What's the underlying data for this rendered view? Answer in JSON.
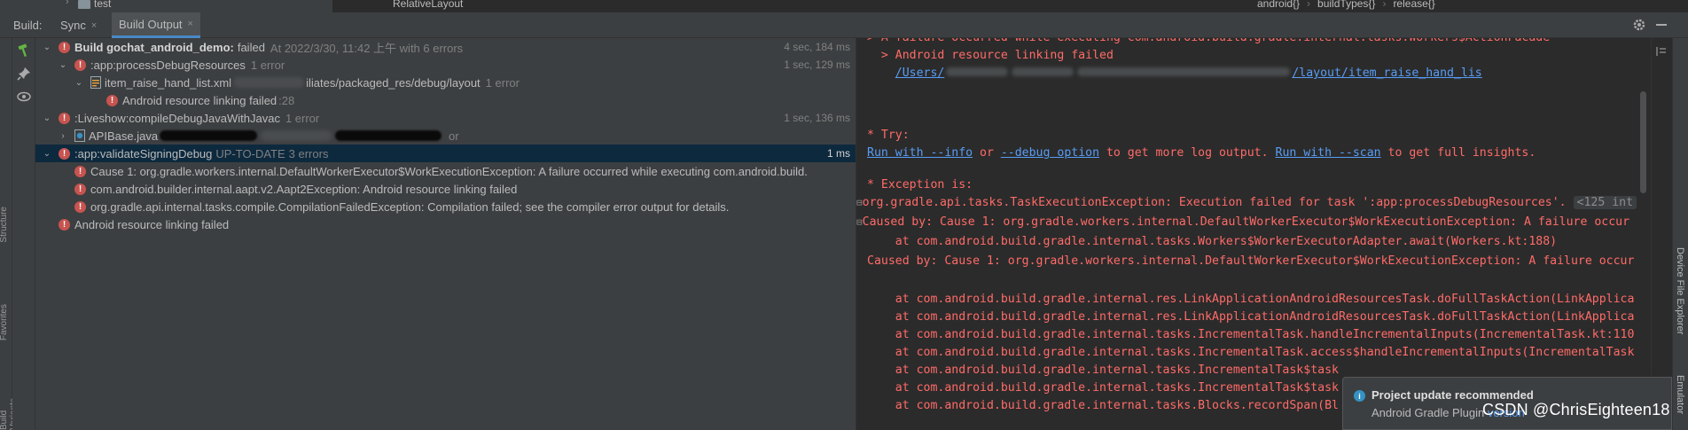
{
  "editor": {
    "tree_item": "test",
    "layout_name": "RelativeLayout",
    "breadcrumbs": [
      "android{}",
      "buildTypes{}",
      "release{}"
    ]
  },
  "toolwindow": {
    "title": "Build:",
    "tabs": [
      {
        "label": "Sync",
        "close": "×"
      },
      {
        "label": "Build Output",
        "close": "×"
      }
    ]
  },
  "stripe": {
    "left_labels": [
      "Structure",
      "Favorites",
      "Build Variants"
    ],
    "right_labels": [
      "Device File Explorer",
      "Emulator"
    ]
  },
  "tree": {
    "root": {
      "name": "Build gochat_android_demo:",
      "status": "failed",
      "meta": "At 2022/3/30, 11:42 上午 with 6 errors",
      "duration": "4 sec, 184 ms"
    },
    "process": {
      "name": ":app:processDebugResources",
      "meta": "1 error",
      "duration": "1 sec, 129 ms"
    },
    "xml_file": {
      "name": "item_raise_hand_list.xml",
      "path": "iliates/packaged_res/debug/layout",
      "meta": "1 error"
    },
    "xml_error": {
      "name": "Android resource linking failed",
      "meta": ":28"
    },
    "compile": {
      "name": ":Liveshow:compileDebugJavaWithJavac",
      "meta": "1 error",
      "duration": "1 sec, 136 ms"
    },
    "java_file": {
      "name": "APIBase.java",
      "meta": "or"
    },
    "validate": {
      "name": ":app:validateSigningDebug",
      "meta": "UP-TO-DATE",
      "errors": "3 errors",
      "duration": "1 ms"
    },
    "causes": [
      "Cause 1: org.gradle.workers.internal.DefaultWorkerExecutor$WorkExecutionException: A failure occurred while executing com.android.build.",
      "com.android.builder.internal.aapt.v2.Aapt2Exception: Android resource linking failed",
      "org.gradle.api.internal.tasks.compile.CompilationFailedException: Compilation failed; see the compiler error output for details."
    ],
    "final_error": "Android resource linking failed"
  },
  "console": {
    "lines": {
      "l0": "> A failure occurred while executing com.android.build.gradle.internal.tasks.Workers$ActionFacade",
      "l1": "  > Android resource linking failed",
      "l2_link_a": "/Users/",
      "l2_link_b": "/layout/item_raise_hand_lis",
      "try": "* Try:",
      "run_info": "Run with --info",
      "or": " or ",
      "run_debug": "--debug option",
      "more": " to get more log output. ",
      "run_scan": "Run with --scan",
      "insights": " to get full insights.",
      "exc": "* Exception is:",
      "task_exc": "org.gradle.api.tasks.TaskExecutionException: Execution failed for task ':app:processDebugResources'.",
      "task_badge": "<125 int",
      "caused1": "Caused by: Cause 1: org.gradle.workers.internal.DefaultWorkerExecutor$WorkExecutionException: A failure occur",
      "at_await": "    at com.android.build.gradle.internal.tasks.Workers$WorkerExecutorAdapter.await(Workers.kt:188)",
      "caused2": "Caused by: Cause 1: org.gradle.workers.internal.DefaultWorkerExecutor$WorkExecutionException: A failure occur",
      "at1": "    at com.android.build.gradle.internal.res.LinkApplicationAndroidResourcesTask.doFullTaskAction(LinkApplica",
      "at2": "    at com.android.build.gradle.internal.res.LinkApplicationAndroidResourcesTask.doFullTaskAction(LinkApplica",
      "at3": "    at com.android.build.gradle.internal.tasks.IncrementalTask.handleIncrementalInputs(IncrementalTask.kt:110",
      "at4": "    at com.android.build.gradle.internal.tasks.IncrementalTask.access$handleIncrementalInputs(IncrementalTask",
      "at5": "    at com.android.build.gradle.internal.tasks.IncrementalTask$task",
      "at6": "    at com.android.build.gradle.internal.tasks.IncrementalTask$task",
      "at7": "    at com.android.build.gradle.internal.tasks.Blocks.recordSpan(Bl"
    }
  },
  "notification": {
    "title": "Project update recommended",
    "body": "Android Gradle Plugin",
    "link": "version"
  },
  "watermark": "CSDN @ChrisEighteen18",
  "colors": {
    "error_red": "#ff6b68",
    "link_blue": "#589df6",
    "selection": "#0d293e",
    "accent": "#4a88c7"
  }
}
